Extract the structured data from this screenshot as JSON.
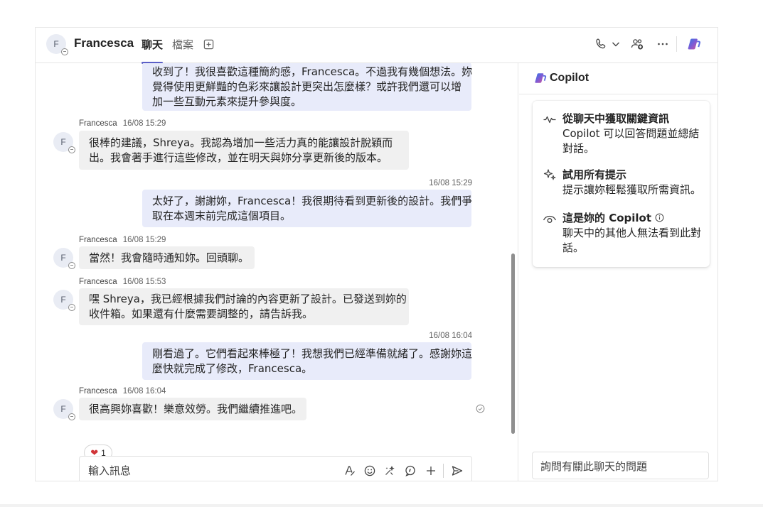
{
  "header": {
    "avatar_initial": "F",
    "contact_name": "Francesca",
    "tabs": [
      {
        "label": "聊天",
        "active": true
      },
      {
        "label": "檔案",
        "active": false
      }
    ],
    "icons": [
      "add-tab-icon",
      "phone-icon",
      "chevron-down-icon",
      "people-add-icon",
      "more-icon",
      "copilot-icon"
    ]
  },
  "messages": [
    {
      "from": "me",
      "lines": [
        "收到了！我很喜歡這種簡約感，Francesca。不過我有幾個想法。妳",
        "覺得使用更鮮豔的色彩來讓設計更突出怎麼樣？或許我們還可以增",
        "加一些互動元素來提升參與度。"
      ]
    },
    {
      "from": "Francesca",
      "time": "16/08 15:29",
      "lines": [
        "很棒的建議，Shreya。我認為增加一些活力真的能讓設計脫穎而",
        "出。我會著手進行這些修改，並在明天與妳分享更新後的版本。"
      ]
    },
    {
      "from": "me",
      "time": "16/08 15:29",
      "lines": [
        "太好了，謝謝妳，Francesca！我很期待看到更新後的設計。我們爭",
        "取在本週末前完成這個項目。"
      ]
    },
    {
      "from": "Francesca",
      "time": "16/08 15:29",
      "lines": [
        "當然！我會隨時通知妳。回頭聊。"
      ]
    },
    {
      "from": "Francesca",
      "time": "16/08 15:53",
      "lines": [
        "嘿 Shreya，我已經根據我們討論的內容更新了設計。已發送到妳的",
        "收件箱。如果還有什麼需要調整的，請告訴我。"
      ]
    },
    {
      "from": "me",
      "time": "16/08 16:04",
      "lines": [
        "剛看過了。它們看起來棒極了！我想我們已經準備就緒了。感謝妳這",
        "麼快就完成了修改，Francesca。"
      ]
    },
    {
      "from": "Francesca",
      "time": "16/08 16:04",
      "lines": [
        "很高興妳喜歡！樂意效勞。我們繼續推進吧。"
      ],
      "reaction": {
        "emoji": "heart",
        "count": "1"
      }
    }
  ],
  "composer": {
    "placeholder": "輸入訊息",
    "icons": [
      "format-icon",
      "emoji-icon",
      "loop-icon",
      "copilot-prompt-icon",
      "plus-icon",
      "send-icon"
    ]
  },
  "copilot": {
    "title": "Copilot",
    "items": [
      {
        "icon": "pulse-icon",
        "title": "從聊天中獲取關鍵資訊",
        "desc": [
          "Copilot 可以回答問題並總結",
          "對話。"
        ]
      },
      {
        "icon": "sparkle-icon",
        "title": "試用所有提示",
        "desc": [
          "提示讓妳輕鬆獲取所需資訊。"
        ]
      },
      {
        "icon": "eye-icon",
        "title": "這是妳的 Copilot",
        "desc": [
          "聊天中的其他人無法看到此對",
          "話。"
        ]
      }
    ],
    "input_placeholder": "詢問有關此聊天的問題"
  },
  "colors": {
    "accent": "#5b5fc7",
    "my_bubble": "#e8ebfa",
    "their_bubble": "#f0f0f0",
    "heart": "#d13438"
  }
}
